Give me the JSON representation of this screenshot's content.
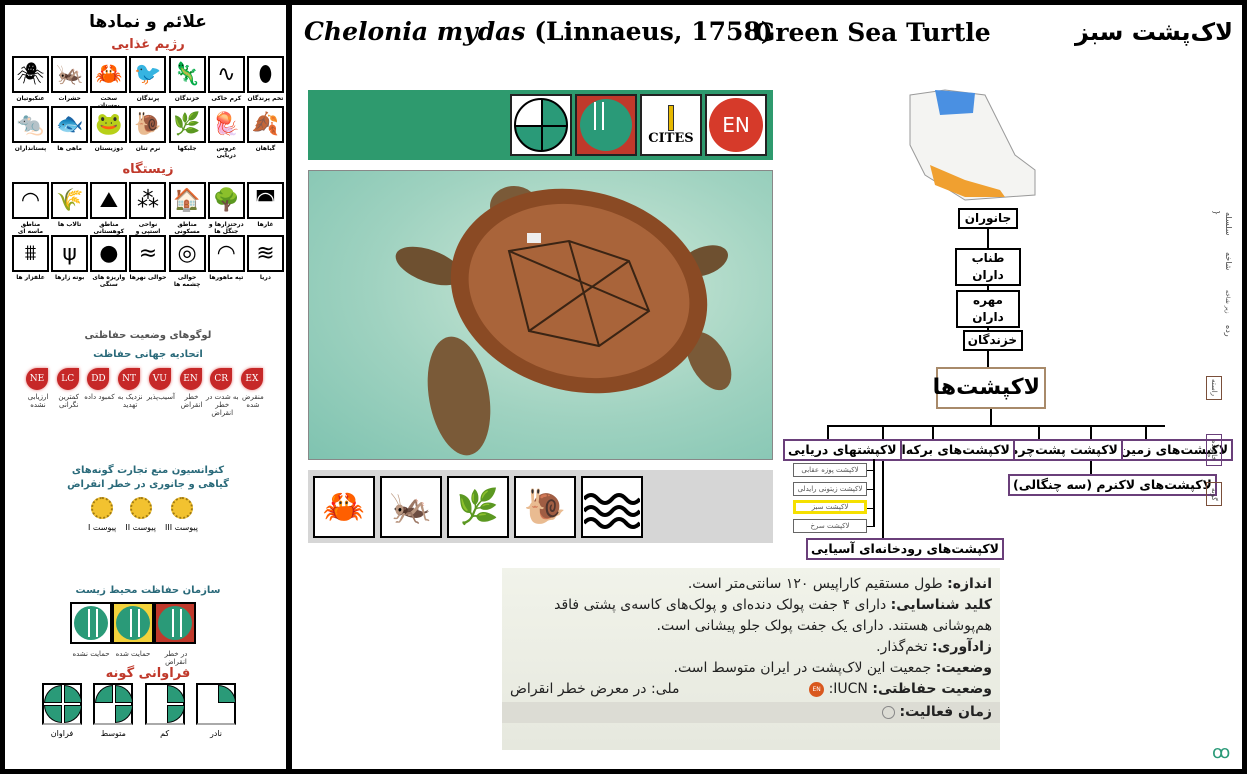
{
  "legend_panel": {
    "title": "علائم و نمادها",
    "diet_title": "رژیم غذایی",
    "diet_row1": [
      {
        "label": "تخم پرندگان",
        "icon": "egg-icon"
      },
      {
        "label": "کرم خاکی",
        "icon": "worm-icon"
      },
      {
        "label": "خزندگان",
        "icon": "lizard-icon"
      },
      {
        "label": "پرندگان",
        "icon": "bird-icon"
      },
      {
        "label": "سخت پوستان",
        "icon": "crab-icon"
      },
      {
        "label": "حشرات",
        "icon": "grasshopper-icon"
      },
      {
        "label": "عنکبوتیان",
        "icon": "spider-icon"
      }
    ],
    "diet_row2": [
      {
        "label": "گیاهان",
        "icon": "leaf-icon"
      },
      {
        "label": "عروس دریایی",
        "icon": "jellyfish-icon"
      },
      {
        "label": "جلبکها",
        "icon": "algae-icon"
      },
      {
        "label": "نرم تنان",
        "icon": "snail-icon"
      },
      {
        "label": "دوزیستان",
        "icon": "frog-icon"
      },
      {
        "label": "ماهی ها",
        "icon": "fish-icon"
      },
      {
        "label": "پستانداران",
        "icon": "rodent-icon"
      }
    ],
    "habitat_title": "زیستگاه",
    "habitat_row1": [
      {
        "label": "غارها",
        "icon": "cave-icon"
      },
      {
        "label": "درختزارها و جنگل ها",
        "icon": "forest-icon"
      },
      {
        "label": "مناطق مسکونی",
        "icon": "house-icon"
      },
      {
        "label": "نواحی استپی و دامنه های کشت",
        "icon": "steppe-icon"
      },
      {
        "label": "مناطق کوهستانی",
        "icon": "mountain-icon"
      },
      {
        "label": "تالاب ها",
        "icon": "reeds-icon"
      },
      {
        "label": "مناطق ماسه ای",
        "icon": "dunes-icon"
      }
    ],
    "habitat_row2": [
      {
        "label": "دریا",
        "icon": "sea-waves-icon"
      },
      {
        "label": "تپه ماهورها",
        "icon": "hills-icon"
      },
      {
        "label": "حوالی چشمه ها",
        "icon": "spring-icon"
      },
      {
        "label": "حوالی نهرها",
        "icon": "stream-icon"
      },
      {
        "label": "واریزه های سنگی",
        "icon": "rocks-icon"
      },
      {
        "label": "بوته زارها",
        "icon": "shrub-icon"
      },
      {
        "label": "علفزار ها",
        "icon": "grass-icon"
      }
    ],
    "conservation_title": "لوگوهای وضعیت حفاظتی",
    "iucn_title": "اتحادیه جهانی حفاظت",
    "iucn": [
      {
        "code": "EX",
        "label": "منقرض شده"
      },
      {
        "code": "CR",
        "label": "به شدت در خطر انقراض"
      },
      {
        "code": "EN",
        "label": "خطر انقراض"
      },
      {
        "code": "VU",
        "label": "آسیب‌پذیر"
      },
      {
        "code": "NT",
        "label": "نزدیک به تهدید"
      },
      {
        "code": "DD",
        "label": "کمبود داده"
      },
      {
        "code": "LC",
        "label": "کمترین نگرانی"
      },
      {
        "code": "NE",
        "label": "ارزیابی نشده"
      }
    ],
    "cites_title_1": "کنوانسیون منع تجارت گونه‌های",
    "cites_title_2": "گیاهی و جانوری در خطر انقراض",
    "cites": [
      {
        "code": "III",
        "label": "پیوست III"
      },
      {
        "code": "II",
        "label": "پیوست II"
      },
      {
        "code": "I",
        "label": "پیوست I"
      }
    ],
    "doe_title": "سازمان حفاظت محیط زیست",
    "doe": [
      {
        "label": "در خطر انقراض",
        "color": "#c0392b"
      },
      {
        "label": "حمایت شده",
        "color": "#f3d23c"
      },
      {
        "label": "حمایت نشده",
        "color": "#ffffff"
      }
    ],
    "abundance_title": "فراوانی گونه",
    "abundance": [
      {
        "label": "نادر",
        "quarters": 1
      },
      {
        "label": "کم",
        "quarters": 2
      },
      {
        "label": "متوسط",
        "quarters": 3
      },
      {
        "label": "فراوان",
        "quarters": 4
      }
    ]
  },
  "header": {
    "scientific_name": "Chelonia mydas",
    "author": "(Linnaeus, 1758)",
    "english_name": "Green Sea Turtle",
    "persian_name": "لاک‌پشت سبز"
  },
  "status_bar": {
    "color": "#2e9a6e",
    "iucn": "EN",
    "cites_label": "CITES",
    "doe_status": "endangered"
  },
  "diet_icons": [
    "crab-icon",
    "grasshopper-icon",
    "algae-icon",
    "snail-icon",
    "sea-waves-icon"
  ],
  "taxonomy": {
    "kingdom": "جانوران",
    "phylum": "طناب داران",
    "subphylum": "مهره داران",
    "class": "خزندگان",
    "order": "لاکپشت‌ها",
    "families": [
      "لاکپشت‌های زمین زی",
      "لاکپشت پشت‌چرمی",
      "لاکپشت‌های برکه‌ای",
      "لاکپشتهای دریایی",
      "لاکپشت‌های لاکنرم (سه چنگالی)",
      "لاکپشت‌های رودخانه‌ای آسیایی"
    ],
    "sea_turtle_genera": [
      "لاکپشت پوزه عقابی",
      "لاکپشت زیتونی رایدلی",
      "لاکپشت سبز",
      "لاکپشت سرخ"
    ],
    "highlighted_genus": "لاکپشت سبز",
    "rank_labels": {
      "kingdom": "سلسله",
      "phylum": "شاخه",
      "subphylum": "زیر شاخه",
      "class": "رده",
      "order": "راسته",
      "family": "خانواده",
      "species": "گونه"
    }
  },
  "description": {
    "size_label": "اندازه:",
    "size_text": "طول مستقیم کاراپیس ۱۲۰ سانتی‌متر است.",
    "key_label": "کلید شناسایی:",
    "key_text": "دارای ۴ جفت پولک دنده‌ای و پولک‌های کاسه‌ی پشتی فاقد هم‌پوشانی هستند. دارای یک جفت پولک جلو پیشانی است.",
    "repro_label": "زادآوری:",
    "repro_text": "تخم‌گذار.",
    "status_label": "وضعیت:",
    "status_text": "جمعیت این لاک‌پشت در ایران متوسط است.",
    "cons_label": "وضعیت حفاظتی:",
    "cons_iucn": "IUCN:",
    "cons_iucn_badge": "EN",
    "cons_national": "ملی: در معرض خطر انقراض",
    "activity_label": "زمان فعالیت:"
  }
}
